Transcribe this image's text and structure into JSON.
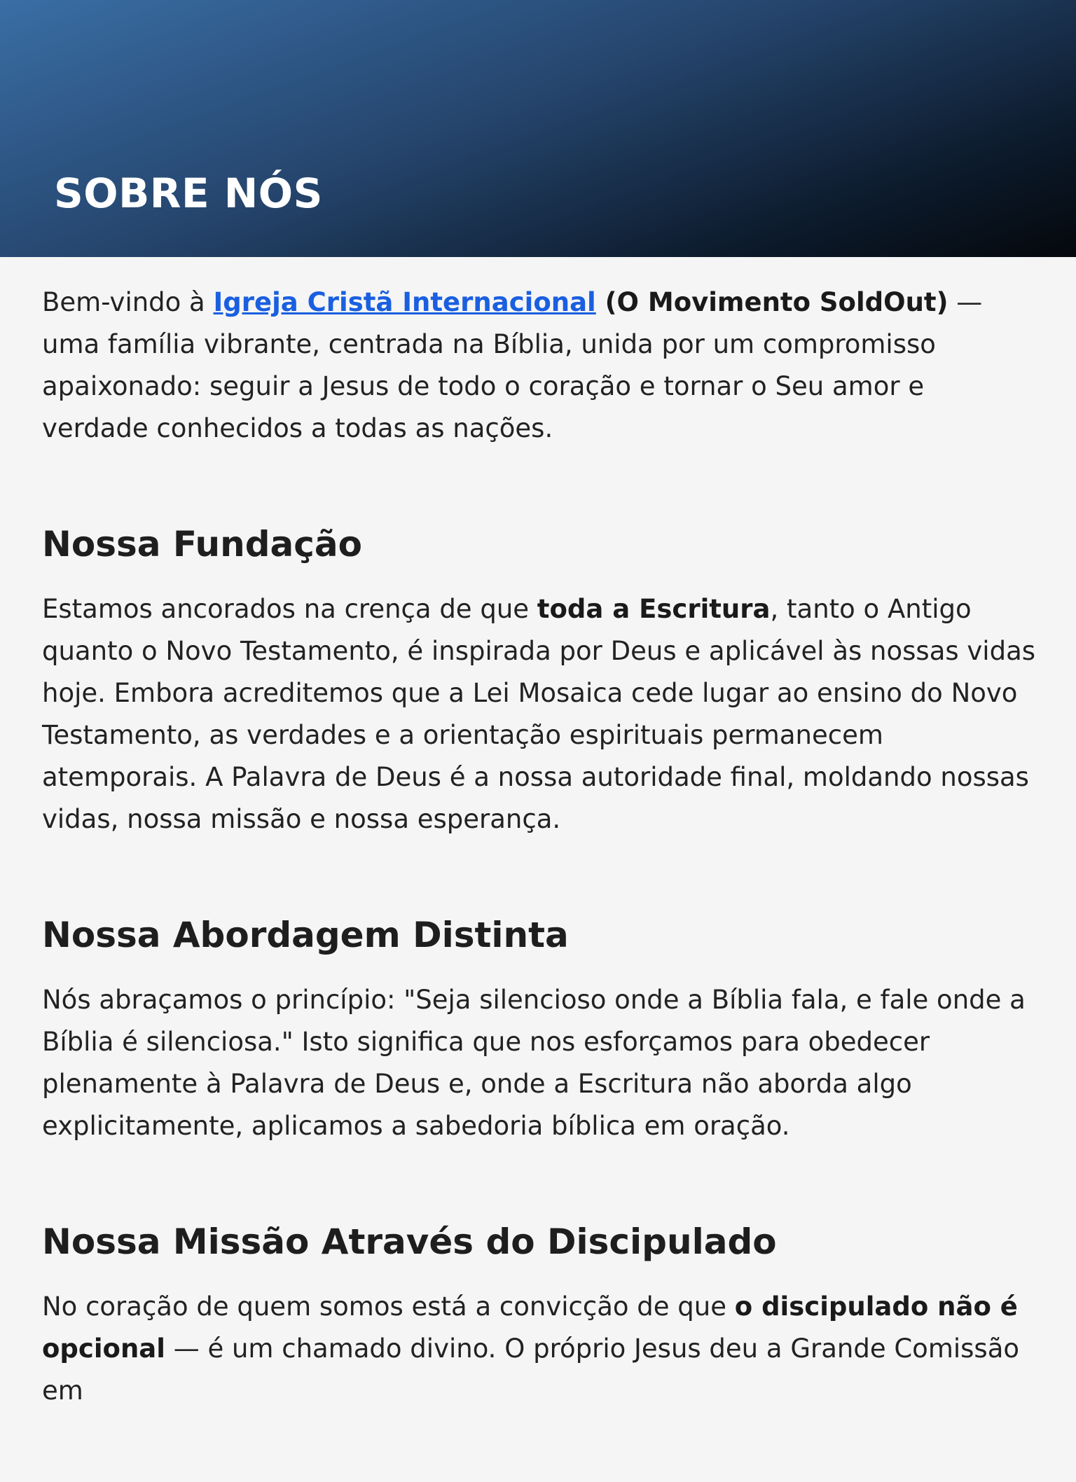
{
  "hero": {
    "title": "SOBRE NÓS"
  },
  "intro": {
    "prefix": "Bem-vindo à ",
    "link_text": "Igreja Cristã Internacional",
    "bold_text": " (O Movimento SoldOut)",
    "suffix": " — uma família vibrante, centrada na Bíblia, unida por um compromisso apaixonado: seguir a Jesus de todo o coração e tornar o Seu amor e verdade conhecidos a todas as nações."
  },
  "sections": [
    {
      "heading": "Nossa Fundação",
      "text_before": "Estamos ancorados na crença de que ",
      "text_bold": "toda a Escritura",
      "text_after": ", tanto o Antigo quanto o Novo Testamento, é inspirada por Deus e aplicável às nossas vidas hoje. Embora acreditemos que a Lei Mosaica cede lugar ao ensino do Novo Testamento, as verdades e a orientação espirituais permanecem atemporais. A Palavra de Deus é a nossa autoridade final, moldando nossas vidas, nossa missão e nossa esperança."
    },
    {
      "heading": "Nossa Abordagem Distinta",
      "text": "Nós abraçamos o princípio: \"Seja silencioso onde a Bíblia fala, e fale onde a Bíblia é silenciosa.\" Isto significa que nos esforçamos para obedecer plenamente à Palavra de Deus e, onde a Escritura não aborda algo explicitamente, aplicamos a sabedoria bíblica em oração."
    },
    {
      "heading": "Nossa Missão Através do Discipulado",
      "text_before": "No coração de quem somos está a convicção de que ",
      "text_bold": "o discipulado não é opcional",
      "text_after": " — é um chamado divino. O próprio Jesus deu a Grande Comissão em"
    }
  ],
  "colors": {
    "link": "#1a5fe0",
    "background": "#f5f5f5",
    "hero_gradient_start": "#3a6ea5",
    "hero_gradient_end": "#05080c"
  }
}
